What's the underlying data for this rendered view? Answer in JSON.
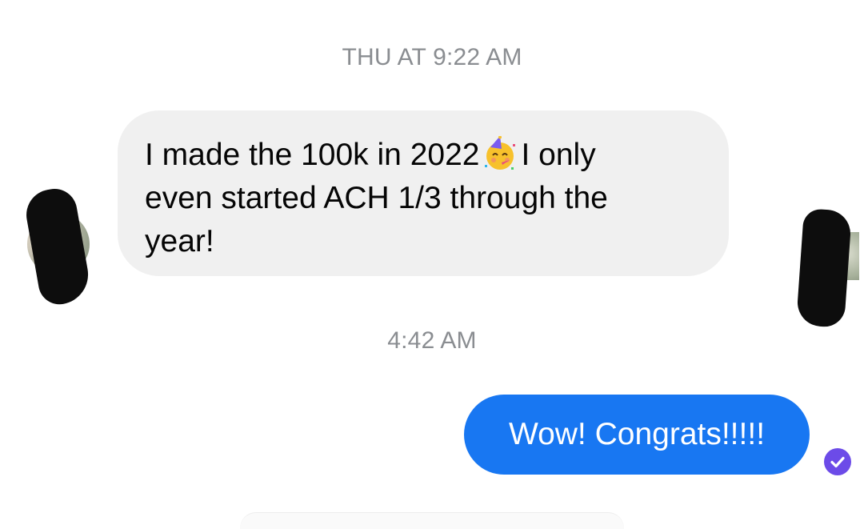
{
  "conversation": {
    "timestamp_1": "THU AT 9:22 AM",
    "timestamp_2": "4:42 AM",
    "incoming_message": {
      "line_1_before_emoji": "I made the 100k in 2022",
      "emoji": "partying-face-icon",
      "line_1_after_emoji": "I only",
      "line_2": "even started ACH 1/3 through the",
      "line_3": "year!"
    },
    "outgoing_message": {
      "text": "Wow! Congrats!!!!!"
    }
  },
  "colors": {
    "incoming_bubble": "#f0f0f0",
    "outgoing_bubble": "#1877f2",
    "timestamp_text": "#8a8d91",
    "seen_badge": "#6c4be8"
  }
}
